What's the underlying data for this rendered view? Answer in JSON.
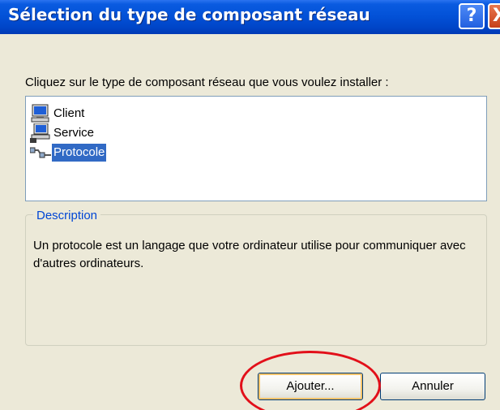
{
  "window": {
    "title": "Sélection du type de composant réseau",
    "help_label": "?",
    "close_label": "X"
  },
  "prompt": "Cliquez sur le type de composant réseau que vous voulez installer :",
  "list": {
    "items": [
      {
        "label": "Client",
        "icon": "client-computer-icon",
        "selected": false
      },
      {
        "label": "Service",
        "icon": "service-computer-icon",
        "selected": false
      },
      {
        "label": "Protocole",
        "icon": "protocol-cable-icon",
        "selected": true
      }
    ]
  },
  "description": {
    "legend": "Description",
    "text": "Un protocole est un langage que votre ordinateur utilise pour communiquer avec d'autres ordinateurs."
  },
  "buttons": {
    "add_label": "Ajouter...",
    "cancel_label": "Annuler"
  },
  "colors": {
    "titlebar": "#0352D8",
    "face": "#ECE9D8",
    "selection": "#316AC5",
    "group_legend": "#0046D5",
    "highlight": "#E2101A"
  }
}
